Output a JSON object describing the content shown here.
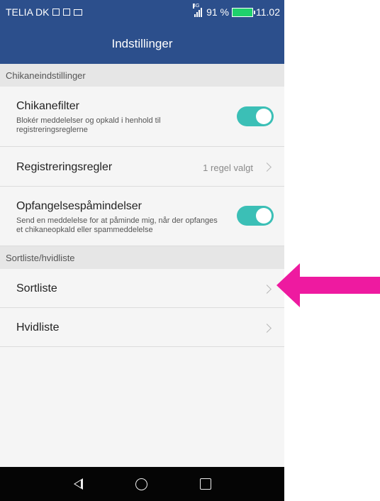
{
  "status_bar": {
    "carrier": "TELIA DK",
    "network": "4G",
    "battery_percent": "91 %",
    "time": "11.02",
    "colors": {
      "bar": "#2c4f8c",
      "battery": "#1fd06c"
    }
  },
  "header": {
    "title": "Indstillinger"
  },
  "sections": {
    "harassment": {
      "label": "Chikaneindstillinger",
      "filter": {
        "title": "Chikanefilter",
        "description": "Blokér meddelelser og opkald i henhold til registreringsreglerne",
        "enabled": true
      },
      "rules": {
        "title": "Registreringsregler",
        "value": "1 regel valgt"
      },
      "notifications": {
        "title": "Opfangelsespåmindelser",
        "description": "Send en meddelelse for at påminde mig, når der opfanges et chikaneopkald eller spammeddelelse",
        "enabled": true
      }
    },
    "lists": {
      "label": "Sortliste/hvidliste",
      "blacklist": {
        "title": "Sortliste"
      },
      "whitelist": {
        "title": "Hvidliste"
      }
    }
  },
  "annotation": {
    "icon": "left-arrow-icon",
    "color": "#ee1aa0"
  },
  "toggle_color": "#3bbfb6"
}
